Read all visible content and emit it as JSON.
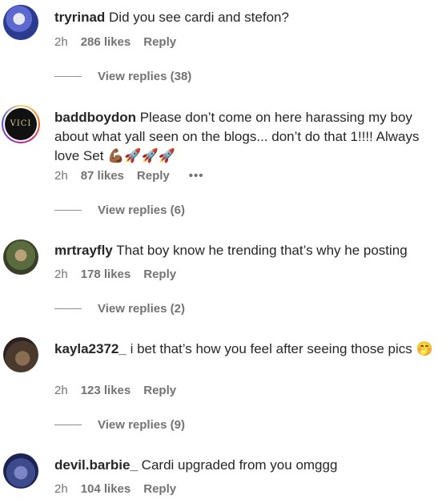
{
  "comments": [
    {
      "username": "tryrinad",
      "text": "Did you see cardi and stefon?",
      "time": "2h",
      "likes": "286 likes",
      "reply": "Reply",
      "view_replies": "View replies (38)"
    },
    {
      "username": "baddboydon",
      "text": "Please don’t come on here harassing my boy about what yall seen on the blogs... don’t do that 1!!!! Always love Set 💪🏾🚀🚀🚀",
      "time": "2h",
      "likes": "87 likes",
      "reply": "Reply",
      "more": "•••",
      "view_replies": "View replies (6)",
      "avatar_text": "VICI"
    },
    {
      "username": "mrtrayfly",
      "text": "That boy know he trending that’s why he posting",
      "time": "2h",
      "likes": "178 likes",
      "reply": "Reply",
      "view_replies": "View replies (2)"
    },
    {
      "username": "kayla2372_",
      "text": "i bet that’s how you feel after seeing those pics 🤭",
      "time": "2h",
      "likes": "123 likes",
      "reply": "Reply",
      "view_replies": "View replies (9)"
    },
    {
      "username": "devil.barbie_",
      "text": "Cardi upgraded from you omggg",
      "time": "2h",
      "likes": "104 likes",
      "reply": "Reply"
    }
  ]
}
